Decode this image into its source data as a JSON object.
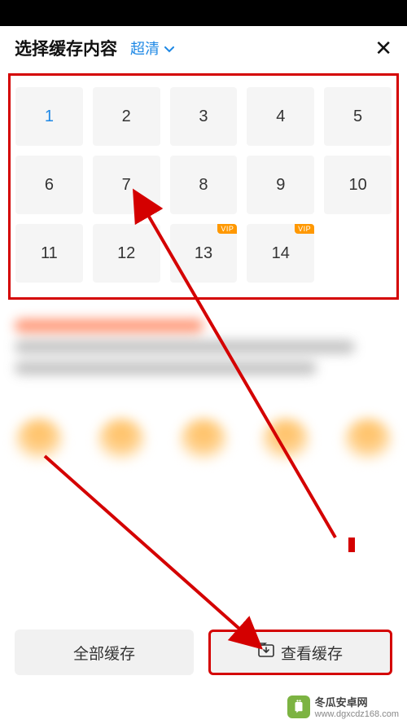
{
  "header": {
    "title": "选择缓存内容",
    "quality_label": "超清",
    "close_glyph": "✕"
  },
  "episodes": [
    {
      "n": "1",
      "selected": true,
      "vip": false
    },
    {
      "n": "2",
      "selected": false,
      "vip": false
    },
    {
      "n": "3",
      "selected": false,
      "vip": false
    },
    {
      "n": "4",
      "selected": false,
      "vip": false
    },
    {
      "n": "5",
      "selected": false,
      "vip": false
    },
    {
      "n": "6",
      "selected": false,
      "vip": false
    },
    {
      "n": "7",
      "selected": false,
      "vip": false
    },
    {
      "n": "8",
      "selected": false,
      "vip": false
    },
    {
      "n": "9",
      "selected": false,
      "vip": false
    },
    {
      "n": "10",
      "selected": false,
      "vip": false
    },
    {
      "n": "11",
      "selected": false,
      "vip": false
    },
    {
      "n": "12",
      "selected": false,
      "vip": false
    },
    {
      "n": "13",
      "selected": false,
      "vip": true
    },
    {
      "n": "14",
      "selected": false,
      "vip": true
    }
  ],
  "vip_tag": "VIP",
  "buttons": {
    "cache_all": "全部缓存",
    "view_cache": "查看缓存"
  },
  "watermark": {
    "site_name": "冬瓜安卓网",
    "site_url": "www.dgxcdz168.com"
  }
}
